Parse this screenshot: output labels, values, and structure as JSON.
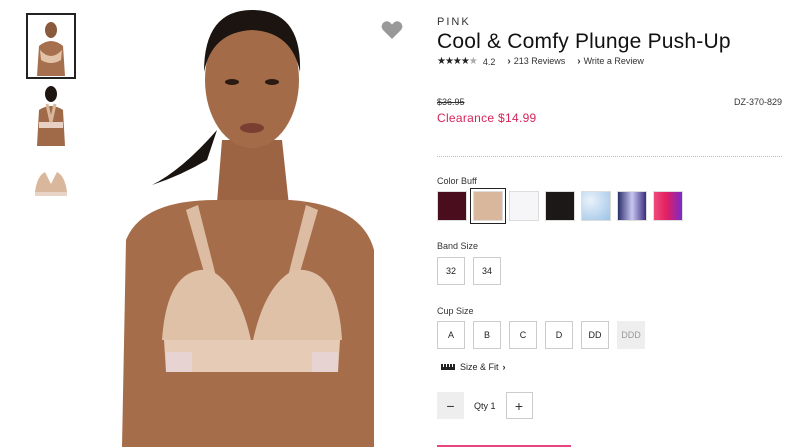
{
  "product": {
    "brand": "PINK",
    "title": "Cool & Comfy Plunge Push-Up",
    "rating": "4.2",
    "rating_stars": 4.2,
    "reviews_label": "213 Reviews",
    "write_review_label": "Write a Review",
    "original_price": "$36.95",
    "sale_price": "Clearance $14.99",
    "sku": "DZ-370-829"
  },
  "color": {
    "label": "Color Buff",
    "selected_index": 1,
    "swatches": [
      {
        "name": "burgundy",
        "color": "#4a0d1e"
      },
      {
        "name": "buff",
        "color": "#d9b79c"
      },
      {
        "name": "white",
        "color": "#f6f6f8"
      },
      {
        "name": "black",
        "color": "#1b1817"
      },
      {
        "name": "blue-tie-dye",
        "color": "#bcd6ee"
      },
      {
        "name": "navy-ombre",
        "color": "#5a4f9e"
      },
      {
        "name": "pink-ombre",
        "color": "#e03a6e"
      }
    ]
  },
  "band": {
    "label": "Band Size",
    "sizes": [
      "32",
      "34"
    ]
  },
  "cup": {
    "label": "Cup Size",
    "sizes": [
      "A",
      "B",
      "C",
      "D",
      "DD",
      "DDD"
    ],
    "disabled": [
      "DDD"
    ]
  },
  "size_fit_label": "Size & Fit",
  "quantity": {
    "label": "Qty 1",
    "minus": "−",
    "plus": "+"
  },
  "icons": {
    "favorite": "heart-icon",
    "size_fit": "ruler-icon",
    "review_chevron": "chevron-right-icon"
  },
  "accent_color": "#d62358"
}
